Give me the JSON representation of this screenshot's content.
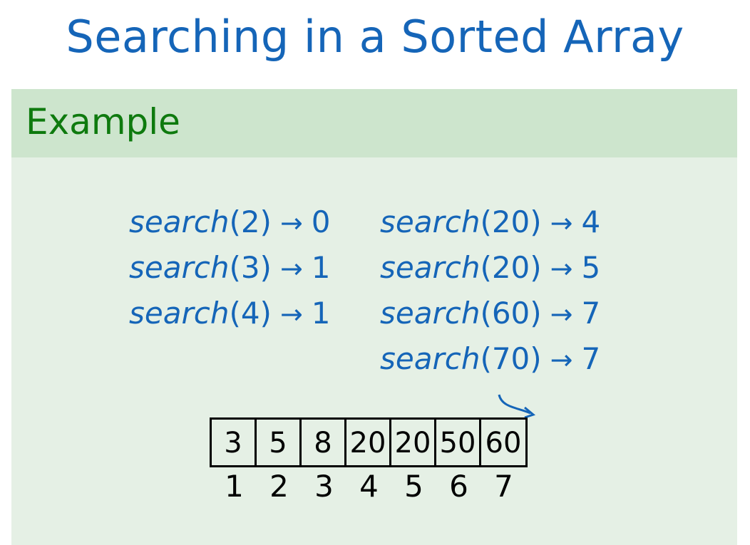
{
  "title": "Searching in a Sorted Array",
  "block": {
    "header": "Example",
    "queries_left": [
      {
        "fn": "search",
        "arg": "(2)",
        "arrow": "→",
        "result": "0"
      },
      {
        "fn": "search",
        "arg": "(3)",
        "arrow": "→",
        "result": "1"
      },
      {
        "fn": "search",
        "arg": "(4)",
        "arrow": "→",
        "result": "1"
      }
    ],
    "queries_right": [
      {
        "fn": "search",
        "arg": "(20)",
        "arrow": "→",
        "result": "4"
      },
      {
        "fn": "search",
        "arg": "(20)",
        "arrow": "→",
        "result": "5"
      },
      {
        "fn": "search",
        "arg": "(60)",
        "arrow": "→",
        "result": "7"
      },
      {
        "fn": "search",
        "arg": "(70)",
        "arrow": "→",
        "result": "7"
      }
    ],
    "array": [
      "3",
      "5",
      "8",
      "20",
      "20",
      "50",
      "60"
    ],
    "indices": [
      "1",
      "2",
      "3",
      "4",
      "5",
      "6",
      "7"
    ]
  },
  "colors": {
    "title": "#1565b8",
    "header_text": "#0e7a0e",
    "header_bg": "#cde5cd",
    "body_bg": "#e5f0e5"
  }
}
